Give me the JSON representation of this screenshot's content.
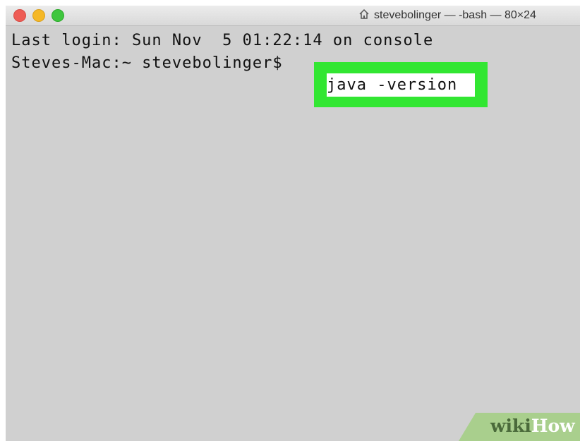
{
  "window": {
    "title": "stevebolinger — -bash — 80×24",
    "title_icon": "home-icon"
  },
  "terminal": {
    "line1": "Last login: Sun Nov  5 01:22:14 on console",
    "prompt": "Steves-Mac:~ stevebolinger$ ",
    "command": "java -version"
  },
  "highlight": {
    "outline_color": "#32e632",
    "fill_color": "#ffffff"
  },
  "watermark": {
    "part1": "wiki",
    "part2": "How",
    "color": "#a9cf8d"
  },
  "colors": {
    "terminal_background": "#d0d0d0",
    "close": "#ee5c55",
    "minimize": "#f5b826",
    "zoom": "#3fc63e"
  }
}
